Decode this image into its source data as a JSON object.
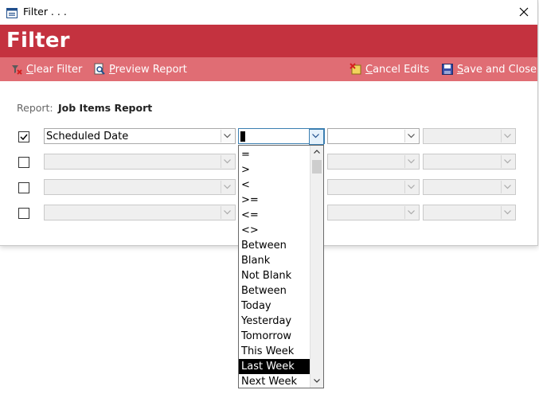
{
  "window": {
    "title": "Filter . . ."
  },
  "banner": {
    "title": "Filter"
  },
  "toolbar": {
    "clear_filter": {
      "mnemonic": "C",
      "rest": "lear Filter"
    },
    "preview_report": {
      "mnemonic": "P",
      "rest": "review Report"
    },
    "cancel_edits": {
      "mnemonic": "C",
      "rest": "ancel Edits"
    },
    "save_close": {
      "mnemonic": "S",
      "rest": "ave and Close"
    }
  },
  "report": {
    "label": "Report:",
    "value": "Job Items Report"
  },
  "rows": [
    {
      "checked": true,
      "field": "Scheduled Date"
    },
    {
      "checked": false,
      "field": ""
    },
    {
      "checked": false,
      "field": ""
    },
    {
      "checked": false,
      "field": ""
    }
  ],
  "operator_dropdown": {
    "options": [
      "=",
      ">",
      "<",
      ">=",
      "<=",
      "<>",
      "Between",
      "Blank",
      "Not Blank",
      "Between",
      "Today",
      "Yesterday",
      "Tomorrow",
      "This Week",
      "Last Week",
      "Next Week"
    ],
    "selected": "Last Week"
  },
  "colors": {
    "banner": "#c4323f",
    "toolbar": "#e06d74"
  }
}
